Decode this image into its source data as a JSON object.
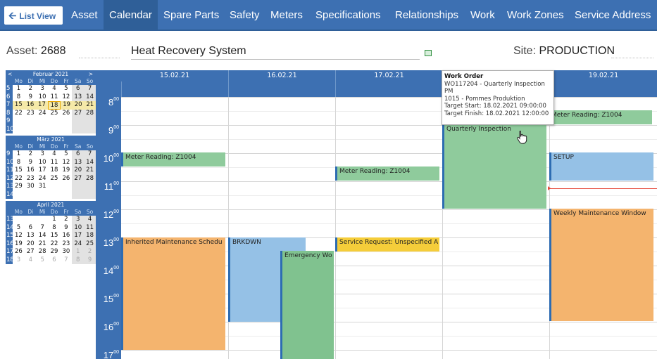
{
  "nav": {
    "list_view": "List View",
    "tabs": [
      "Asset",
      "Calendar",
      "Spare Parts",
      "Safety",
      "Meters",
      "Specifications",
      "Relationships",
      "Work",
      "Work Zones",
      "Service Address"
    ],
    "active_tab": "Calendar"
  },
  "header": {
    "asset_label": "Asset:",
    "asset_value": "2688",
    "description": "Heat Recovery System",
    "site_label": "Site:",
    "site_value": "PRODUCTION"
  },
  "mini_calendars": [
    {
      "title": "Februar 2021",
      "prev": "<",
      "next": ">",
      "weeks": [
        {
          "wn": "5",
          "days": [
            "1",
            "2",
            "3",
            "4",
            "5",
            "6",
            "7"
          ]
        },
        {
          "wn": "6",
          "days": [
            "8",
            "9",
            "10",
            "11",
            "12",
            "13",
            "14"
          ]
        },
        {
          "wn": "7",
          "days": [
            "15",
            "16",
            "17",
            "18",
            "19",
            "20",
            "21"
          ]
        },
        {
          "wn": "8",
          "days": [
            "22",
            "23",
            "24",
            "25",
            "26",
            "27",
            "28"
          ]
        },
        {
          "wn": "9",
          "days": [
            "",
            "",
            "",
            "",
            "",
            "",
            ""
          ]
        },
        {
          "wn": "10",
          "days": [
            "",
            "",
            "",
            "",
            "",
            "",
            ""
          ]
        }
      ]
    },
    {
      "title": "März 2021",
      "weeks": [
        {
          "wn": "9",
          "days": [
            "1",
            "2",
            "3",
            "4",
            "5",
            "6",
            "7"
          ]
        },
        {
          "wn": "10",
          "days": [
            "8",
            "9",
            "10",
            "11",
            "12",
            "13",
            "14"
          ]
        },
        {
          "wn": "11",
          "days": [
            "15",
            "16",
            "17",
            "18",
            "19",
            "20",
            "21"
          ]
        },
        {
          "wn": "12",
          "days": [
            "22",
            "23",
            "24",
            "25",
            "26",
            "27",
            "28"
          ]
        },
        {
          "wn": "13",
          "days": [
            "29",
            "30",
            "31",
            "",
            "",
            "",
            ""
          ]
        },
        {
          "wn": "14",
          "days": [
            "",
            "",
            "",
            "",
            "",
            "",
            ""
          ]
        }
      ]
    },
    {
      "title": "April 2021",
      "weeks": [
        {
          "wn": "13",
          "days": [
            "",
            "",
            "",
            "1",
            "2",
            "3",
            "4"
          ]
        },
        {
          "wn": "14",
          "days": [
            "5",
            "6",
            "7",
            "8",
            "9",
            "10",
            "11"
          ]
        },
        {
          "wn": "15",
          "days": [
            "12",
            "13",
            "14",
            "15",
            "16",
            "17",
            "18"
          ]
        },
        {
          "wn": "16",
          "days": [
            "19",
            "20",
            "21",
            "22",
            "23",
            "24",
            "25"
          ]
        },
        {
          "wn": "17",
          "days": [
            "26",
            "27",
            "28",
            "29",
            "30",
            "1",
            "2"
          ]
        },
        {
          "wn": "18",
          "days": [
            "3",
            "4",
            "5",
            "6",
            "7",
            "8",
            "9"
          ]
        }
      ]
    }
  ],
  "weekday_labels": [
    "Mo",
    "Di",
    "Mi",
    "Do",
    "Fr",
    "Sa",
    "So"
  ],
  "hours": [
    "8",
    "9",
    "10",
    "11",
    "12",
    "13",
    "14",
    "15",
    "16",
    "17"
  ],
  "hour_suffix": "00",
  "days": [
    "15.02.21",
    "16.02.21",
    "17.02.21",
    "18.02.21",
    "19.02.21"
  ],
  "events": [
    {
      "label": "Meter Reading: Z1004",
      "color": "green"
    },
    {
      "label": "Inherited Maintenance Schedu",
      "color": "orange"
    },
    {
      "label": "BRKDWN",
      "color": "blue"
    },
    {
      "label": "Emergency Wo",
      "color": "green"
    },
    {
      "label": "Meter Reading: Z1004",
      "color": "green"
    },
    {
      "label": "Service Request: Unspecified A",
      "color": "yellow"
    },
    {
      "label": "Quarterly Inspection",
      "color": "green"
    },
    {
      "label": "Meter Reading: Z1004",
      "color": "green"
    },
    {
      "label": "SETUP",
      "color": "blue"
    },
    {
      "label": "Weekly Maintenance Window",
      "color": "orange"
    }
  ],
  "tooltip": {
    "title": "Work Order",
    "line1": "WO117204 - Quarterly Inspection",
    "line2": "PM",
    "line3": "1015 - Pommes Produktion",
    "line4": "Target Start: 18.02.2021 09:00:00",
    "line5": "Target Finish: 18.02.2021 12:00:00"
  },
  "colors": {
    "nav": "#3d70b2",
    "green": "#8fcb9c",
    "blue": "#95c1e6",
    "orange": "#f4b46e",
    "yellow": "#f5cd3a"
  }
}
